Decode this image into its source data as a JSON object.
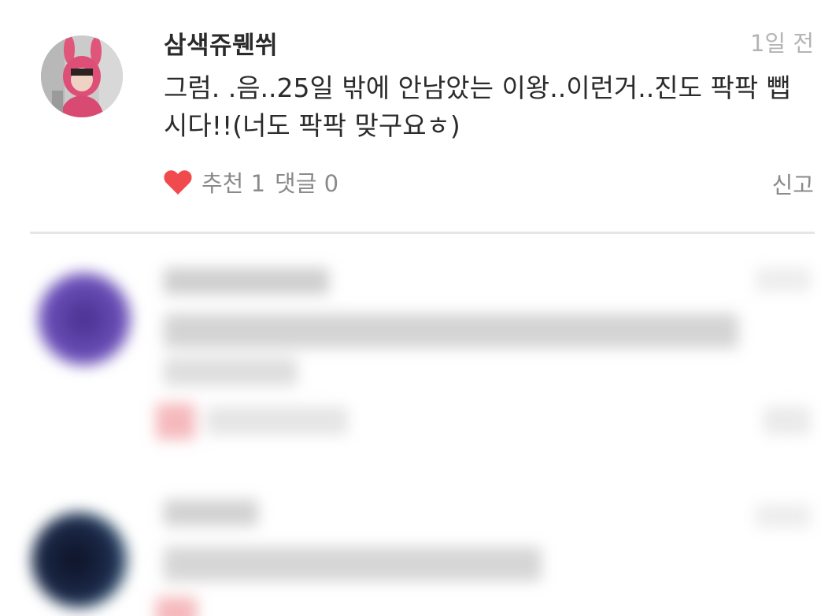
{
  "comment": {
    "author": "삼색쥬뭰쒸",
    "timestamp": "1일 전",
    "body": "그럼. .음..25일 밖에 안남았는 이왕..이런거..진도 팍팍 뺍시다!!(너도 팍팍 맞구요ㅎ)",
    "like_label": "추천 1",
    "reply_label": "댓글 0",
    "report_label": "신고",
    "colors": {
      "heart": "#f04a4f",
      "author": "#2a2a2a",
      "meta": "#8a8a8a",
      "timestamp": "#b4b4b4"
    },
    "icons": {
      "like": "heart-icon"
    }
  },
  "blurred_comments": [
    {
      "avatar_color": "#5b3fa0"
    },
    {
      "avatar_color": "#1c2a4a"
    }
  ]
}
